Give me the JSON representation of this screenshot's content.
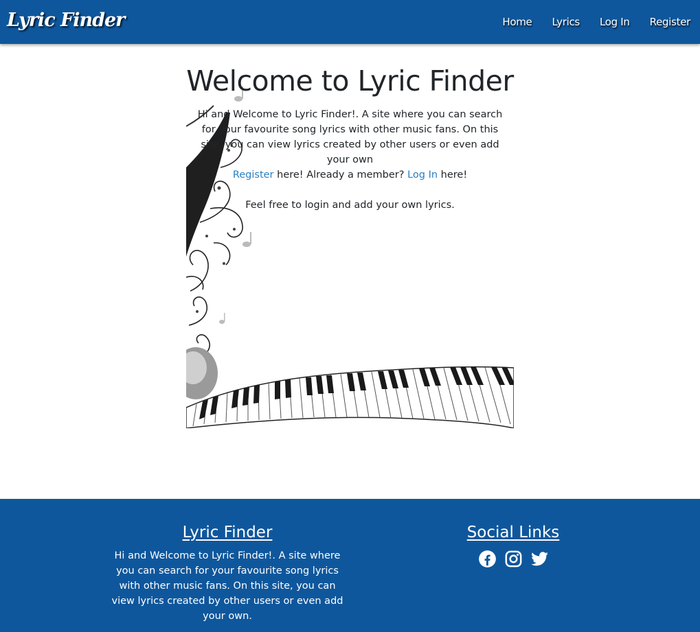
{
  "nav": {
    "brand": "Lyric Finder",
    "links": [
      "Home",
      "Lyrics",
      "Log In",
      "Register"
    ]
  },
  "hero": {
    "title": "Welcome to Lyric Finder",
    "intro": "Hi and Welcome to Lyric Finder!. A site where you can search for your favourite song lyrics with other music fans. On this site, you can view lyrics created by other users or even add your own",
    "register_link": "Register",
    "register_text": " here! Already a member? ",
    "login_link": "Log In",
    "login_text": " here!",
    "cta": "Feel free to login and add your own lyrics."
  },
  "footer": {
    "about_heading": "Lyric Finder",
    "about_text": "Hi and Welcome to Lyric Finder!. A site where you can search for your favourite song lyrics with other music fans. On this site, you can view lyrics created by other users or even add your own.",
    "social_heading": "Social Links",
    "social_icons": [
      "facebook-icon",
      "instagram-icon",
      "twitter-icon"
    ]
  },
  "colors": {
    "primary": "#0f579c",
    "link": "#2a7fc1",
    "text": "#212529"
  }
}
